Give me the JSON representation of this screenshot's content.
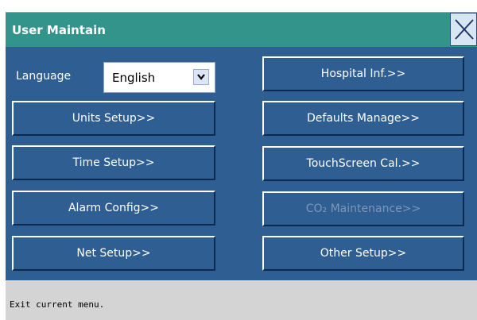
{
  "window": {
    "title": "User Maintain"
  },
  "language": {
    "label": "Language",
    "selected": "English"
  },
  "left_buttons": [
    {
      "label": "Units Setup>>"
    },
    {
      "label": "Time Setup>>"
    },
    {
      "label": "Alarm Config>>"
    },
    {
      "label": "Net Setup>>"
    }
  ],
  "right_buttons": [
    {
      "label": "Hospital Inf.>>"
    },
    {
      "label": "Defaults Manage>>"
    },
    {
      "label": "TouchScreen Cal.>>"
    },
    {
      "label": "CO₂ Maintenance>>",
      "disabled": true
    },
    {
      "label": "Other Setup>>"
    }
  ],
  "status": {
    "text": "Exit current menu."
  },
  "colors": {
    "titlebar": "#33948b",
    "panel": "#2f5e93",
    "statusbar": "#d4d4d4"
  },
  "icons": {
    "close": "close-x-icon",
    "dropdown": "chevron-down-icon"
  }
}
